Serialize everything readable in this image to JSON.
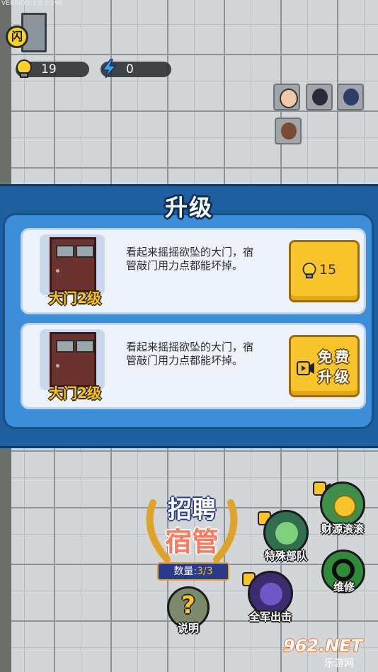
{
  "version": "VERSION:1.0.1.196",
  "exit_button": {
    "label": "闪"
  },
  "resources": {
    "bulbs": "19",
    "energy": "0"
  },
  "panel": {
    "title": "升级",
    "cards": [
      {
        "level": "大门2级",
        "description": "看起来摇摇欲坠的大门，宿管敲门用力点都能坏掉。",
        "price": "15"
      },
      {
        "level": "大门2级",
        "description": "看起来摇摇欲坠的大门，宿管敲门用力点都能坏掉。",
        "free_label": "免费升级"
      }
    ]
  },
  "recruit": {
    "line1": "招聘",
    "line2": "宿管",
    "count_label": "数量:",
    "count_value": "3/3"
  },
  "buttons": {
    "help": {
      "icon": "?",
      "label": "说明"
    },
    "special": "特殊部队",
    "all_attack": "全军出击",
    "wealth": "财源滚滚",
    "repair": "维修"
  },
  "watermark": {
    "top": "962.NET",
    "bottom": "乐游网"
  },
  "colors": {
    "panel": "#1e5fa0",
    "card": "#eef3fb",
    "gold": "#f7c52b",
    "level_text": "#f6c21c"
  }
}
